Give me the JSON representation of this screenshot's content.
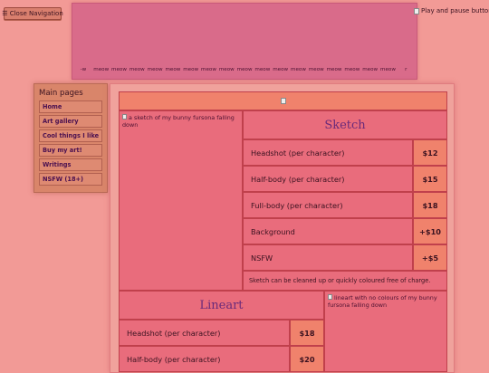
{
  "nav": {
    "toggle_label": "☰ Close Navigation"
  },
  "banner": {
    "marquee": [
      "-w",
      "meow",
      "meow",
      "meow",
      "meow",
      "meow",
      "meow",
      "meow",
      "meow",
      "meow",
      "meow",
      "meow",
      "meow",
      "meow",
      "meow",
      "meow",
      "meow",
      "meow",
      "r"
    ]
  },
  "player": {
    "alt": "Play and pause button"
  },
  "sidebar": {
    "heading": "Main pages",
    "items": [
      {
        "label": "Home"
      },
      {
        "label": "Art gallery"
      },
      {
        "label": "Cool things I like"
      },
      {
        "label": "Buy my art!"
      },
      {
        "label": "Writings"
      },
      {
        "label": "NSFW (18+)"
      }
    ]
  },
  "commissions": {
    "sketch": {
      "image_alt": "a sketch of my bunny fursona falling down",
      "title": "Sketch",
      "rows": [
        {
          "label": "Headshot (per character)",
          "price": "$12"
        },
        {
          "label": "Half-body (per character)",
          "price": "$15"
        },
        {
          "label": "Full-body (per character)",
          "price": "$18"
        },
        {
          "label": "Background",
          "price": "+$10"
        },
        {
          "label": "NSFW",
          "price": "+$5"
        }
      ],
      "note": "Sketch can be cleaned up or quickly coloured free of charge."
    },
    "lineart": {
      "title": "Lineart",
      "image_alt": "lineart with no colours of my bunny fursona falling down",
      "rows": [
        {
          "label": "Headshot (per character)",
          "price": "$18"
        },
        {
          "label": "Half-body (per character)",
          "price": "$20"
        }
      ]
    }
  }
}
